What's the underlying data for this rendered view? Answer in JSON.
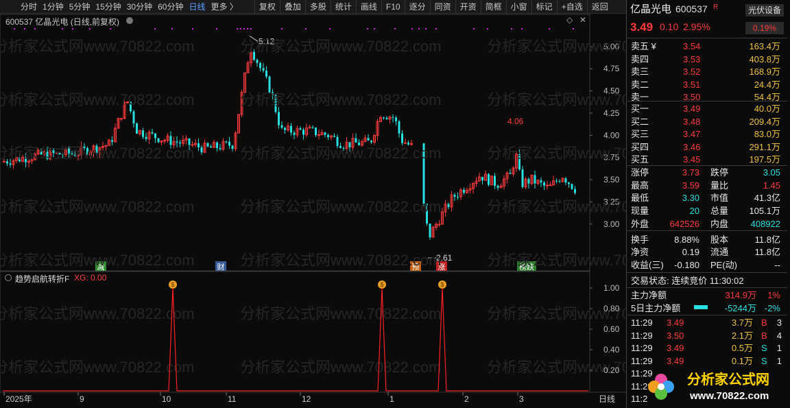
{
  "toolbar": {
    "periods": [
      "分时",
      "1分钟",
      "5分钟",
      "15分钟",
      "30分钟",
      "60分钟",
      "日线",
      "更多 〉"
    ],
    "active": "日线",
    "tools": [
      "复权",
      "叠加",
      "多股",
      "统计",
      "画线",
      "F10",
      "逐分",
      "同资",
      "开资",
      "简框",
      "小窗",
      "标记",
      "+自选",
      "返回"
    ]
  },
  "chart": {
    "title": "600537 亿晶光电 (日线,前复权)",
    "diamond": "◇",
    "close": "✕",
    "high_label": "5.12",
    "low_label": "2.61",
    "peak_label": "4.06",
    "yticks": [
      "5.00",
      "4.75",
      "4.50",
      "4.25",
      "4.00",
      "3.75",
      "3.50",
      "3.25",
      "3.00"
    ],
    "events": [
      {
        "t": "减",
        "c": "#2e8b2e"
      },
      {
        "t": "财",
        "c": "#3a5a9a"
      },
      {
        "t": "预",
        "c": "#c06010"
      },
      {
        "t": "涨",
        "c": "#c02020"
      },
      {
        "t": "榜跌",
        "c": "#2e7d2e"
      }
    ],
    "xlabels": [
      "2025年",
      "9",
      "10",
      "11",
      "12",
      "1",
      "2",
      "3"
    ],
    "period_tag": "日线"
  },
  "indicator": {
    "name": "趋势启航转折F",
    "value_label": "XG: 0.00",
    "yticks": [
      "1.00",
      "0.80",
      "0.60",
      "0.40",
      "0.20"
    ]
  },
  "chart_data": {
    "type": "candlestick",
    "title": "600537 亿晶光电 (日线,前复权)",
    "ylim": [
      2.55,
      5.2
    ],
    "max": 5.12,
    "min": 2.61,
    "local_peak": 4.06,
    "signals_xg": [
      0,
      0,
      1,
      0,
      1,
      0,
      1,
      0
    ],
    "indicator_ylim": [
      0,
      1
    ]
  },
  "quote": {
    "name": "亿晶光电",
    "code": "600537",
    "r": "R",
    "pv_btn": "光伏设备",
    "price": "3.49",
    "chg": "0.10",
    "pct": "2.95%",
    "sector_pct": "0.19%"
  },
  "asks": [
    {
      "l": "卖五 ¥",
      "p": "3.54",
      "v": "163.4万"
    },
    {
      "l": "卖四",
      "p": "3.53",
      "v": "403.8万"
    },
    {
      "l": "卖三",
      "p": "3.52",
      "v": "168.9万"
    },
    {
      "l": "卖二",
      "p": "3.51",
      "v": "24.4万"
    },
    {
      "l": "卖一",
      "p": "3.50",
      "v": "54.4万"
    }
  ],
  "bids": [
    {
      "l": "买一",
      "p": "3.49",
      "v": "40.0万"
    },
    {
      "l": "买二",
      "p": "3.48",
      "v": "209.4万"
    },
    {
      "l": "买三",
      "p": "3.47",
      "v": "83.0万"
    },
    {
      "l": "买四",
      "p": "3.46",
      "v": "291.1万"
    },
    {
      "l": "买五",
      "p": "3.45",
      "v": "197.5万"
    }
  ],
  "stats": [
    {
      "a": "涨停",
      "av": "3.73",
      "ac": "red",
      "b": "跌停",
      "bv": "3.05",
      "bc": "grn"
    },
    {
      "a": "最高",
      "av": "3.59",
      "ac": "red",
      "b": "量比",
      "bv": "1.45",
      "bc": "red"
    },
    {
      "a": "最低",
      "av": "3.30",
      "ac": "grn",
      "b": "市值",
      "bv": "41.3亿",
      "bc": "wht"
    },
    {
      "a": "现量",
      "av": "20",
      "ac": "grn",
      "b": "总量",
      "bv": "105.1万",
      "bc": "wht"
    },
    {
      "a": "外盘",
      "av": "642526",
      "ac": "red",
      "b": "内盘",
      "bv": "408922",
      "bc": "grn"
    },
    {
      "a": "换手",
      "av": "8.88%",
      "ac": "wht",
      "b": "股本",
      "bv": "11.8亿",
      "bc": "wht"
    },
    {
      "a": "净资",
      "av": "0.19",
      "ac": "wht",
      "b": "流通",
      "bv": "11.8亿",
      "bc": "wht"
    },
    {
      "a": "收益(三)",
      "av": "-0.180",
      "ac": "wht",
      "b": "PE(动)",
      "bv": "--",
      "bc": "wht"
    }
  ],
  "trade_state": "交易状态: 连续竞价 11:30:02",
  "flow": [
    {
      "l": "主力净额",
      "v": "314.9万",
      "p": "1%",
      "c": "red"
    },
    {
      "l": "5日主力净额",
      "v": "-5244万",
      "p": "-2%",
      "c": "grn"
    }
  ],
  "ticks": [
    {
      "t": "11:29",
      "p": "3.49",
      "v": "3.7万",
      "s": "B",
      "n": "3"
    },
    {
      "t": "11:29",
      "p": "3.50",
      "v": "2.1万",
      "s": "B",
      "n": "4"
    },
    {
      "t": "11:29",
      "p": "3.49",
      "v": "0.5万",
      "s": "S",
      "n": "1"
    },
    {
      "t": "11:29",
      "p": "3.49",
      "v": "0.1万",
      "s": "S",
      "n": "1"
    },
    {
      "t": "11:29",
      "p": "",
      "v": "",
      "s": "",
      "n": ""
    },
    {
      "t": "11:29",
      "p": "",
      "v": "",
      "s": "",
      "n": ""
    },
    {
      "t": "11:2",
      "p": "",
      "v": "",
      "s": "",
      "n": ""
    }
  ],
  "watermark": {
    "brand": "分析家公式网",
    "url": "www.70822.com",
    "tile": "分析家公式网www.70822.com"
  }
}
